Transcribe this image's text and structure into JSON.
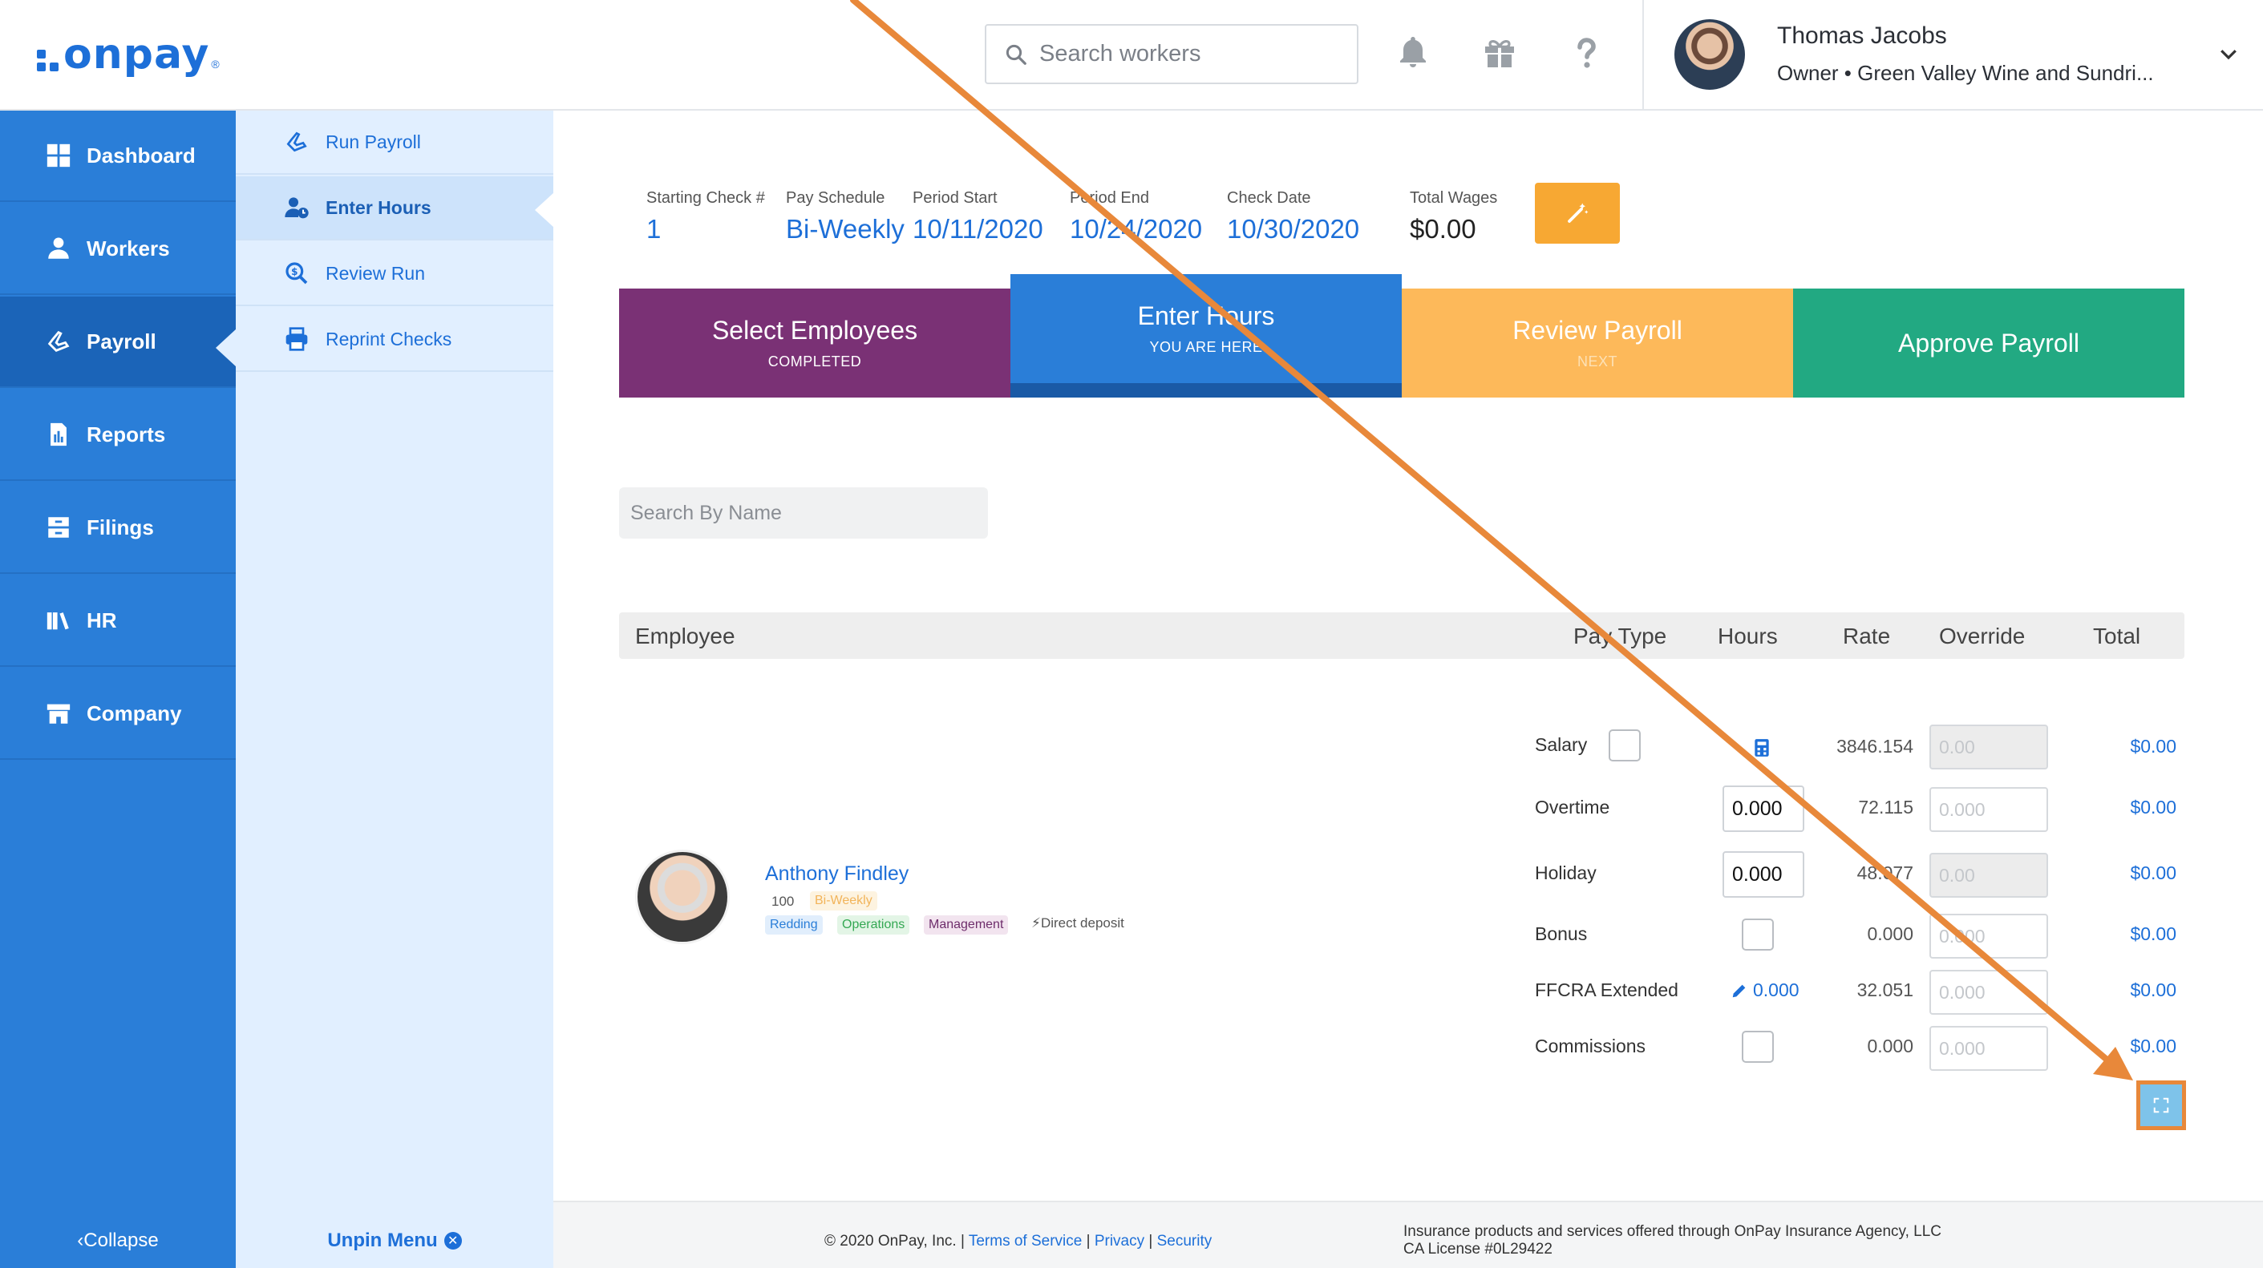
{
  "header": {
    "logo_text": "onpay",
    "logo_reg": "®",
    "search_placeholder": "Search workers",
    "user_name": "Thomas Jacobs",
    "user_role": "Owner • Green Valley Wine and Sundri..."
  },
  "sidebar": {
    "items": [
      {
        "label": "Dashboard",
        "icon": "dashboard-icon"
      },
      {
        "label": "Workers",
        "icon": "workers-icon"
      },
      {
        "label": "Payroll",
        "icon": "payroll-icon"
      },
      {
        "label": "Reports",
        "icon": "reports-icon"
      },
      {
        "label": "Filings",
        "icon": "filings-icon"
      },
      {
        "label": "HR",
        "icon": "hr-icon"
      },
      {
        "label": "Company",
        "icon": "company-icon"
      }
    ],
    "active": "Payroll",
    "collapse_label": "Collapse"
  },
  "submenu": {
    "items": [
      {
        "label": "Run Payroll"
      },
      {
        "label": "Enter Hours"
      },
      {
        "label": "Review Run"
      },
      {
        "label": "Reprint Checks"
      }
    ],
    "active": "Enter Hours",
    "unpin_label": "Unpin Menu"
  },
  "payroll_info": {
    "starting_check_label": "Starting Check #",
    "starting_check_value": "1",
    "pay_schedule_label": "Pay Schedule",
    "pay_schedule_value": "Bi-Weekly",
    "period_start_label": "Period Start",
    "period_start_value": "10/11/2020",
    "period_end_label": "Period End",
    "period_end_value": "10/24/2020",
    "check_date_label": "Check Date",
    "check_date_value": "10/30/2020",
    "total_wages_label": "Total Wages",
    "total_wages_value": "$0.00"
  },
  "steps": [
    {
      "title": "Select Employees",
      "sub": "COMPLETED",
      "color": "#7a3175"
    },
    {
      "title": "Enter Hours",
      "sub": "YOU ARE HERE",
      "color": "#2a7ed8"
    },
    {
      "title": "Review Payroll",
      "sub": "NEXT",
      "color": "#fdb95a"
    },
    {
      "title": "Approve Payroll",
      "sub": "",
      "color": "#22a982"
    }
  ],
  "name_search_placeholder": "Search By Name",
  "table": {
    "headers": {
      "employee": "Employee",
      "pay_type": "Pay Type",
      "hours": "Hours",
      "rate": "Rate",
      "override": "Override",
      "total": "Total"
    }
  },
  "employee": {
    "name": "Anthony Findley",
    "id": "100",
    "schedule": "Bi-Weekly",
    "tags": [
      "Redding",
      "Operations",
      "Management"
    ],
    "deposit": "Direct deposit"
  },
  "pay_rows": [
    {
      "type": "Salary",
      "hours": "",
      "rate": "3846.154",
      "override": "0.00",
      "total": "$0.00"
    },
    {
      "type": "Overtime",
      "hours": "0.000",
      "rate": "72.115",
      "override": "0.000",
      "total": "$0.00"
    },
    {
      "type": "Holiday",
      "hours": "0.000",
      "rate": "48.077",
      "override": "0.00",
      "total": "$0.00"
    },
    {
      "type": "Bonus",
      "hours": "",
      "rate": "0.000",
      "override": "0.000",
      "total": "$0.00"
    },
    {
      "type": "FFCRA Extended",
      "hours": "0.000",
      "rate": "32.051",
      "override": "0.000",
      "total": "$0.00"
    },
    {
      "type": "Commissions",
      "hours": "",
      "rate": "0.000",
      "override": "0.000",
      "total": "$0.00"
    }
  ],
  "footer": {
    "copyright": "© 2020 OnPay, Inc. |",
    "terms": "Terms of Service",
    "sep1": "|",
    "privacy": "Privacy",
    "sep2": "|",
    "security": "Security",
    "insurance_line1": "Insurance products and services offered through OnPay Insurance Agency, LLC",
    "insurance_line2": "CA License #0L29422"
  },
  "colors": {
    "brand_blue": "#2a7ed8",
    "accent_orange": "#f7a833",
    "annotation_orange": "#e8883a"
  }
}
